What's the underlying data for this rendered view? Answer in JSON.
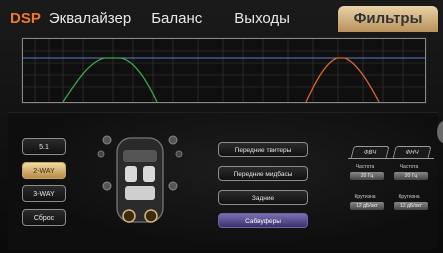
{
  "tabs": {
    "dsp": "DSP",
    "equalizer": "Эквалайзер",
    "balance": "Баланс",
    "outputs": "Выходы",
    "filters": "Фильтры"
  },
  "mode_buttons": {
    "mode_51": "5.1",
    "mode_2way": "2-WAY",
    "mode_3way": "3-WAY",
    "reset": "Сброс"
  },
  "speaker_buttons": {
    "front_tweeters": "Передние твитеры",
    "front_midbass": "Передние мидбасы",
    "rear": "Задние",
    "subwoofers": "Сабвуферы"
  },
  "filter_panel": {
    "hpf_tab": "ФВЧ",
    "lpf_tab": "ФНЧ",
    "freq_label_hpf": "Частота",
    "freq_label_lpf": "Частота",
    "freq_value_hpf": "20 Гц",
    "freq_value_lpf": "20 Гц",
    "slope_label_hpf": "Крутизна",
    "slope_label_lpf": "Крутизна",
    "slope_value_hpf": "12 дБ/окт",
    "slope_value_lpf": "12 дБ/окт"
  },
  "colors": {
    "accent_orange": "#f1782a",
    "active_tab_gold": "#d8b57a",
    "active_speaker_purple": "#6f61a4",
    "curve_green": "#39a64a",
    "curve_orange": "#d8662a",
    "graph_line_blue": "#5a7bd6"
  }
}
